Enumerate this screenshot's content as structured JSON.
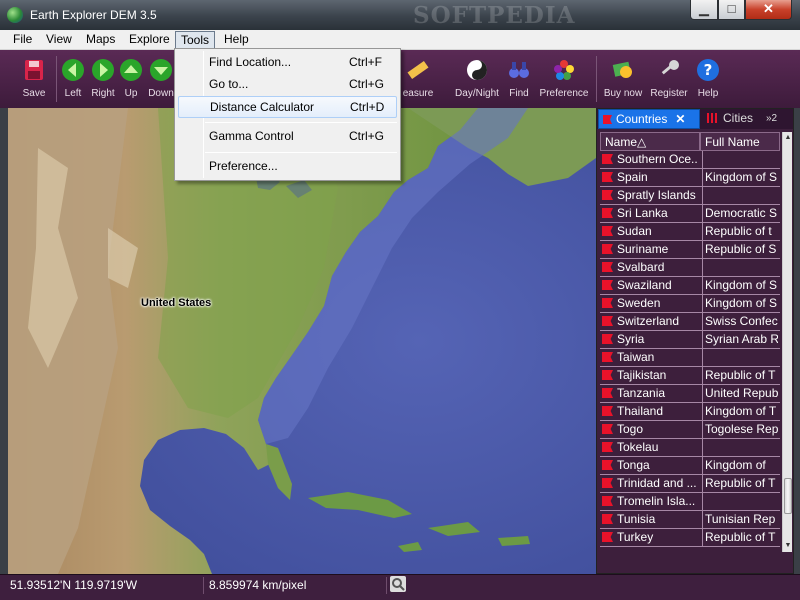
{
  "window": {
    "title": "Earth Explorer DEM 3.5",
    "watermark": "SOFTPEDIA"
  },
  "window_controls": {
    "minimize": "▁",
    "maximize": "□",
    "close": "✕"
  },
  "menubar": {
    "items": [
      {
        "label": "File"
      },
      {
        "label": "View"
      },
      {
        "label": "Maps"
      },
      {
        "label": "Explore"
      },
      {
        "label": "Tools"
      },
      {
        "label": "Help"
      }
    ]
  },
  "toolbar": {
    "save": "Save",
    "left": "Left",
    "right": "Right",
    "up": "Up",
    "down": "Down",
    "measure": "easure",
    "day_night": "Day/Night",
    "find": "Find",
    "preference": "Preference",
    "buy_now": "Buy now",
    "register": "Register",
    "help": "Help"
  },
  "tools_menu": {
    "items": [
      {
        "label": "Find Location...",
        "shortcut": "Ctrl+F"
      },
      {
        "label": "Go to...",
        "shortcut": "Ctrl+G"
      },
      {
        "label": "Distance Calculator",
        "shortcut": "Ctrl+D"
      },
      {
        "label": "Gamma Control",
        "shortcut": "Ctrl+G"
      },
      {
        "label": "Preference...",
        "shortcut": ""
      }
    ]
  },
  "map": {
    "label": "United States"
  },
  "panel": {
    "tabs": {
      "countries": "Countries",
      "cities": "Cities",
      "more": "»2"
    },
    "columns": {
      "name": "Name",
      "sort_indicator": "△",
      "full": "Full Name"
    },
    "rows": [
      {
        "name": "Southern Oce...",
        "full": ""
      },
      {
        "name": "Spain",
        "full": "Kingdom of S"
      },
      {
        "name": "Spratly Islands",
        "full": ""
      },
      {
        "name": "Sri Lanka",
        "full": "Democratic S"
      },
      {
        "name": "Sudan",
        "full": "Republic of t"
      },
      {
        "name": "Suriname",
        "full": "Republic of S"
      },
      {
        "name": "Svalbard",
        "full": ""
      },
      {
        "name": "Swaziland",
        "full": "Kingdom of S"
      },
      {
        "name": "Sweden",
        "full": "Kingdom of S"
      },
      {
        "name": "Switzerland",
        "full": "Swiss Confec"
      },
      {
        "name": "Syria",
        "full": "Syrian Arab R"
      },
      {
        "name": "Taiwan",
        "full": ""
      },
      {
        "name": "Tajikistan",
        "full": "Republic of T"
      },
      {
        "name": "Tanzania",
        "full": "United Repub"
      },
      {
        "name": "Thailand",
        "full": "Kingdom of T"
      },
      {
        "name": "Togo",
        "full": "Togolese Rep"
      },
      {
        "name": "Tokelau",
        "full": ""
      },
      {
        "name": "Tonga",
        "full": "Kingdom of"
      },
      {
        "name": "Trinidad and ...",
        "full": "Republic of T"
      },
      {
        "name": "Tromelin Isla...",
        "full": ""
      },
      {
        "name": "Tunisia",
        "full": "Tunisian Rep"
      },
      {
        "name": "Turkey",
        "full": "Republic of T"
      }
    ]
  },
  "status": {
    "coords": "51.93512'N  119.9719'W",
    "scale": "8.859974 km/pixel"
  },
  "colors": {
    "accent": "#1a73e8",
    "panel_bg": "#3d1f3c",
    "toolbar_bg": "#4a2347",
    "flag": "#e8122a"
  }
}
